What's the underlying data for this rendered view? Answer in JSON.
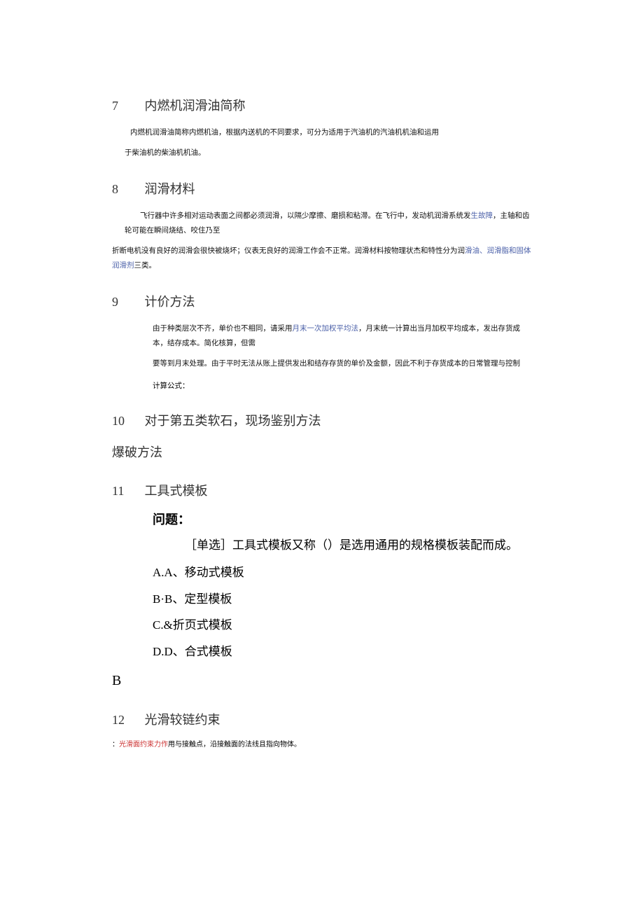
{
  "s7": {
    "num": "7",
    "title": "内燃机润滑油简称",
    "p1": "内燃机润滑油简称内燃机油，根据内送机的不同要求，可分为适用于汽油机的汽油机机油和运用",
    "p2": "于柴油机的柴油机机油。"
  },
  "s8": {
    "num": "8",
    "title": "润滑材料",
    "p1a": "飞行器中许多相对运动表面之间都必须润滑，以隔少摩擦、磨损和粘滞。在飞行中，发动机润滑系统发",
    "link1": "生故障",
    "p1b": "，主轴和齿轮可能在瞬间烧结、咬住乃至",
    "p2a": "折断电机没有良好的润滑会很快被烧坏；仪表无良好的润滑工作会不正常。润滑材料按物理状杰和特性分为润",
    "link2": "滑油、润滑脂和固体润滑剂",
    "p2b": "三类。"
  },
  "s9": {
    "num": "9",
    "title": "计价方法",
    "p1a": "由于种类层次不齐，单价也不相同，请采用",
    "link1": "月末一次加权平均法",
    "p1b": "，月末统一计算出当月加权平均成本，发出存货成本，结存成本。简化核算，但需",
    "p2": "要等到月末处理。由于平时无法从账上提供发出和结存存货的单价及金额，因此不利于存货成本的日常管理与控制",
    "formula": "计算公式："
  },
  "s10": {
    "num": "10",
    "title": "对于第五类软石，现场鉴别方法",
    "sub": "爆破方法"
  },
  "s11": {
    "num": "11",
    "title": "工具式模板",
    "q_label": "问题：",
    "q_text": "［单选］工具式模板又称（）是选用通用的规格模板装配而成。",
    "optA": "A.A、移动式模板",
    "optB": "B·B、定型模板",
    "optC": "C.&折页式模板",
    "optD": "D.D、合式模板",
    "answer": "B"
  },
  "s12": {
    "num": "12",
    "title": "光滑较链约束",
    "note_lead": "：",
    "note_link": "光滑面约束力作",
    "note_tail": "用与接触点，沿接触面的法线且指向物体。"
  }
}
